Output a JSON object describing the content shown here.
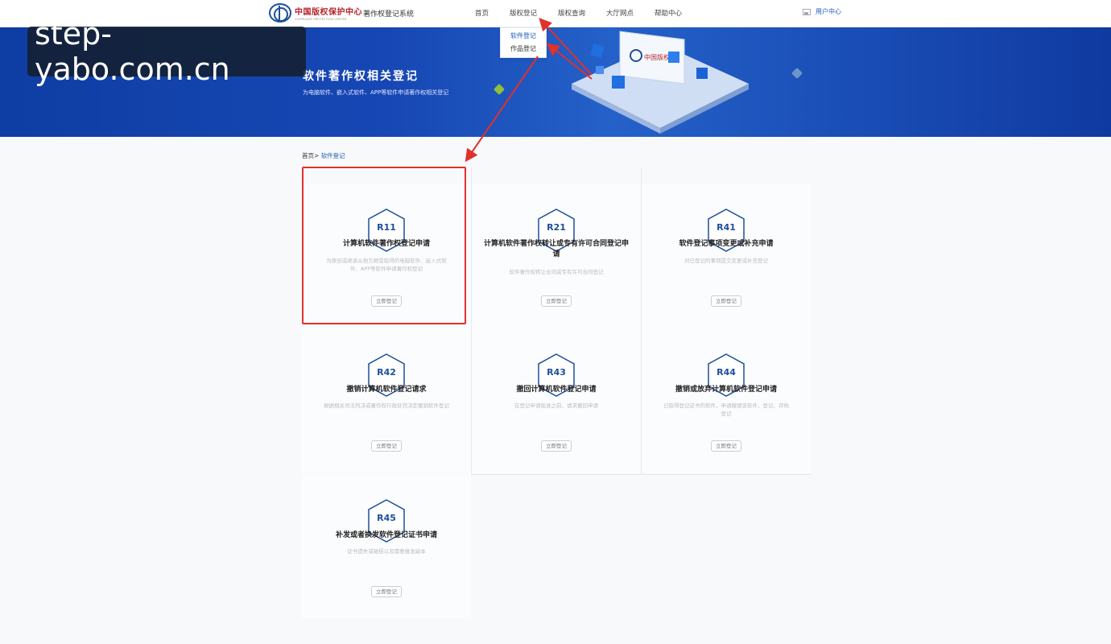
{
  "header": {
    "logo_cn": "中国版权保护中心",
    "logo_en": "COPYRIGHT PROTECTION CENTER",
    "system_name": "著作权登记系统",
    "nav": [
      "首页",
      "版权登记",
      "版权查询",
      "大厅网点",
      "帮助中心"
    ],
    "user_center": "用户中心"
  },
  "dropdown": {
    "items": [
      "软件登记",
      "作品登记"
    ]
  },
  "watermark": "step-yabo.com.cn",
  "banner": {
    "title": "软件著作权相关登记",
    "subtitle": "为电脑软件、嵌入式软件、APP等软件申请著作权相关登记"
  },
  "breadcrumb": {
    "home": "首页>",
    "current": "软件登记"
  },
  "cards": [
    {
      "code": "R11",
      "title": "计算机软件著作权登记申请",
      "desc": "为原创或继承从他方继受取得的电脑软件、嵌入式软件、APP等软件申请著作权登记",
      "button": "立即登记"
    },
    {
      "code": "R21",
      "title": "计算机软件著作权转让或专有许可合同登记申请",
      "desc": "软件著作权转让合同或专有许可合同登记",
      "button": "立即登记"
    },
    {
      "code": "R41",
      "title": "软件登记事项变更或补充申请",
      "desc": "对已登记的事项提交变更或补充登记",
      "button": "立即登记"
    },
    {
      "code": "R42",
      "title": "撤销计算机软件登记请求",
      "desc": "根据相关司法判决或著作权行政处罚决定撤销软件登记",
      "button": "立即登记"
    },
    {
      "code": "R43",
      "title": "撤回计算机软件登记申请",
      "desc": "在登记申请批准之前，请求撤回申请",
      "button": "立即登记"
    },
    {
      "code": "R44",
      "title": "撤销或放弃计算机软件登记申请",
      "desc": "已取得登记证书的软件，申请撤销该软件，登记、存档登记",
      "button": "立即登记"
    },
    {
      "code": "R45",
      "title": "补发或者换发软件登记证书申请",
      "desc": "证书遗失或破损以及需要换发副本",
      "button": "立即登记"
    }
  ],
  "colors": {
    "accent": "#1d5db6",
    "highlight": "#e0312b",
    "banner_blue": "#1747b4"
  }
}
